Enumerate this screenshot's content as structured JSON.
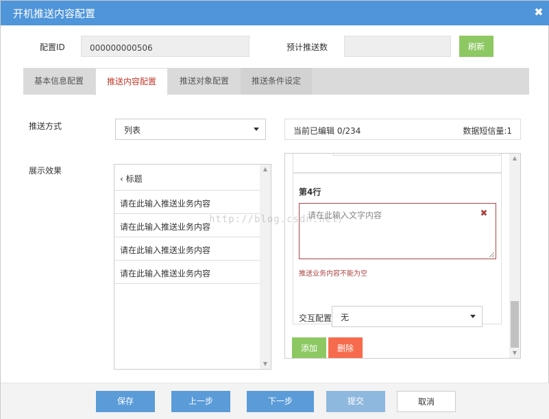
{
  "window": {
    "title": "开机推送内容配置"
  },
  "header": {
    "config_id_label": "配置ID",
    "config_id_value": "000000000506",
    "estimate_label": "预计推送数",
    "estimate_value": "",
    "refresh_label": "刷新"
  },
  "tabs": [
    {
      "label": "基本信息配置",
      "active": false
    },
    {
      "label": "推送内容配置",
      "active": true
    },
    {
      "label": "推送对象配置",
      "active": false
    },
    {
      "label": "推送条件设定",
      "active": false
    }
  ],
  "form": {
    "push_mode_label": "推送方式",
    "push_mode_value": "列表",
    "edit_status": "当前已编辑 0/234",
    "sms_count": "数据短信量:1",
    "display_label": "展示效果"
  },
  "preview": {
    "title": "‹ 标题",
    "rows": [
      "请在此输入推送业务内容",
      "请在此输入推送业务内容",
      "请在此输入推送业务内容",
      "请在此输入推送业务内容"
    ]
  },
  "editor": {
    "line_title": "第4行",
    "text_placeholder": "请在此输入文字内容",
    "error_text": "推送业务内容不能为空",
    "interaction_label": "交互配置",
    "interaction_value": "无",
    "add_label": "添加",
    "delete_label": "删除"
  },
  "footer": {
    "save": "保存",
    "prev": "上一步",
    "next": "下一步",
    "submit": "提交",
    "cancel": "取消"
  },
  "watermark": "http://blog.csdn.net/",
  "colors": {
    "titlebar": "#4f95d9",
    "green": "#8dc862",
    "red": "#f66b4d",
    "error": "#a94442",
    "active_tab_text": "#c0392b",
    "blue_button": "#5a9bd8"
  }
}
